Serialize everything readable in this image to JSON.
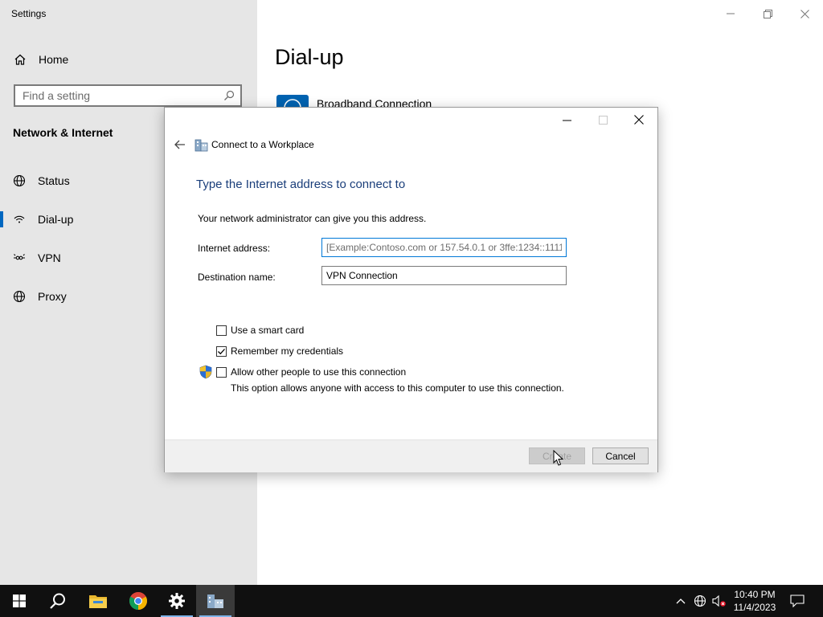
{
  "settings": {
    "window_title": "Settings",
    "home_label": "Home",
    "search_placeholder": "Find a setting",
    "section_heading": "Network & Internet",
    "nav_items": [
      {
        "label": "Status",
        "icon": "globe-icon"
      },
      {
        "label": "Dial-up",
        "icon": "dialup-icon",
        "selected": true
      },
      {
        "label": "VPN",
        "icon": "vpn-icon"
      },
      {
        "label": "Proxy",
        "icon": "globe-icon"
      }
    ],
    "page_heading": "Dial-up",
    "connections": [
      {
        "label": "Broadband Connection",
        "icon": "broadband-connection-icon"
      }
    ]
  },
  "dialog": {
    "title": "Connect to a Workplace",
    "heading": "Type the Internet address to connect to",
    "info": "Your network administrator can give you this address.",
    "fields": {
      "internet_address": {
        "label": "Internet address:",
        "value": "",
        "placeholder": "[Example:Contoso.com or 157.54.0.1 or 3ffe:1234::1111]"
      },
      "destination_name": {
        "label": "Destination name:",
        "value": "VPN Connection"
      }
    },
    "checkboxes": {
      "smart_card": {
        "label": "Use a smart card",
        "checked": false
      },
      "remember_credentials": {
        "label": "Remember my credentials",
        "checked": true
      },
      "allow_others": {
        "label": "Allow other people to use this connection",
        "checked": false,
        "note": "This option allows anyone with access to this computer to use this connection."
      }
    },
    "buttons": {
      "create": "Create",
      "cancel": "Cancel"
    }
  },
  "taskbar": {
    "time": "10:40 PM",
    "date": "11/4/2023",
    "pinned": [
      "windows-start-icon",
      "search-icon",
      "file-explorer-icon",
      "chrome-icon",
      "settings-gear-icon",
      "connect-workplace-icon"
    ]
  },
  "colors": {
    "accent": "#0067c0",
    "heading_blue": "#1a3e7a",
    "taskbar": "#101010",
    "sidebar": "#e6e6e6"
  }
}
